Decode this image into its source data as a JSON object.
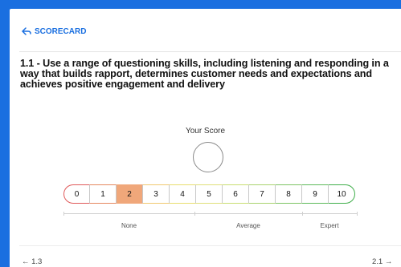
{
  "header": {
    "back_label": "SCORECARD"
  },
  "question": {
    "title": "1.1 - Use a range of questioning skills, including listening and responding in a way that builds rapport, determines customer needs and expectations and achieves positive engagement and delivery"
  },
  "score": {
    "label": "Your Score",
    "selected": 2,
    "options": [
      "0",
      "1",
      "2",
      "3",
      "4",
      "5",
      "6",
      "7",
      "8",
      "9",
      "10"
    ],
    "option_colors": [
      "#e05a5a",
      "#e5885f",
      "#f0a77a",
      "#f0c870",
      "#e8de6e",
      "#e0e07a",
      "#c9de72",
      "#a9d36e",
      "#7dc464",
      "#5dba5a",
      "#3fae4a"
    ]
  },
  "bands": {
    "none": "None",
    "average": "Average",
    "expert": "Expert"
  },
  "nav": {
    "prev": "← 1.3",
    "next": "2.1 →"
  },
  "colors": {
    "accent": "#1a6fe0",
    "selected_fill": "#f0a77a"
  }
}
